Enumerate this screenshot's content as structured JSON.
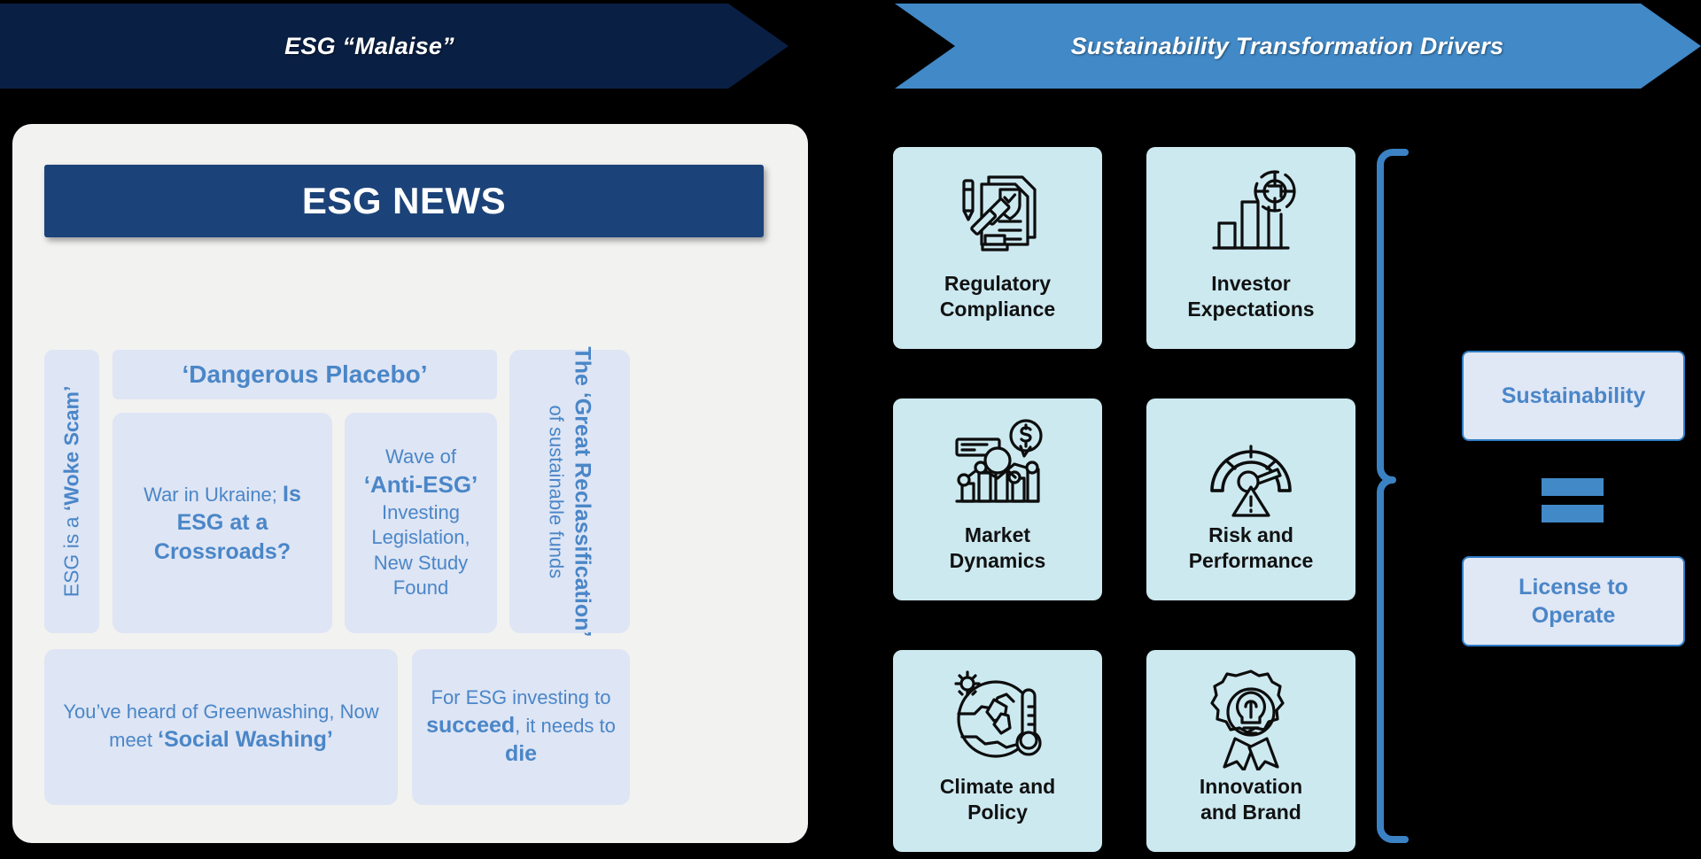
{
  "header": {
    "left_arrow_label": "ESG “Malaise”",
    "right_arrow_label": "Sustainability Transformation Drivers",
    "left_arrow_color": "#0A1F44",
    "right_arrow_color": "#4189C7"
  },
  "news_panel": {
    "title": "ESG NEWS",
    "title_bar_color": "#1C4379",
    "panel_bg": "#F2F2F0",
    "tile_bg": "#DEE5F4",
    "text_color": "#4A86C8",
    "tiles": {
      "woke_scam": {
        "plain": "ESG is a ",
        "bold": "‘Woke Scam’"
      },
      "dangerous_placebo": "‘Dangerous Placebo’",
      "ukraine": {
        "plain_1": "War in Ukraine; ",
        "bold_1": "Is ESG at a Crossroads?"
      },
      "anti_esg": {
        "plain_1": "Wave of ",
        "bold_1": "‘Anti-ESG’",
        "plain_2": " Investing Legislation, New Study Found"
      },
      "reclassification": {
        "line_1": "The ‘Great Reclassification’",
        "line_2": "of sustainable funds"
      },
      "greenwashing": {
        "plain_1": "You’ve heard of Greenwashing, Now meet ",
        "bold_1": "‘Social Washing’"
      },
      "succeed_die": {
        "plain_1": "For ESG investing to ",
        "bold_1": "succeed",
        "plain_2": ", it needs to ",
        "bold_2": "die"
      }
    }
  },
  "drivers": {
    "card_bg": "#CCE9F0",
    "items": [
      {
        "icon": "document-shield-gavel-icon",
        "label_line_1": "Regulatory",
        "label_line_2": "Compliance"
      },
      {
        "icon": "bar-chart-target-icon",
        "label_line_1": "Investor",
        "label_line_2": "Expectations"
      },
      {
        "icon": "market-chart-dollar-icon",
        "label_line_1": "Market",
        "label_line_2": "Dynamics"
      },
      {
        "icon": "gauge-warning-icon",
        "label_line_1": "Risk and",
        "label_line_2": "Performance"
      },
      {
        "icon": "globe-sun-thermometer-icon",
        "label_line_1": "Climate and",
        "label_line_2": "Policy"
      },
      {
        "icon": "award-lightbulb-icon",
        "label_line_1": "Innovation",
        "label_line_2": "and Brand"
      }
    ]
  },
  "outcomes": {
    "brace_color": "#3B82C4",
    "equals_color": "#4189C7",
    "box_border": "#2E7CC4",
    "box_bg": "#E0E7F5",
    "sustainability": "Sustainability",
    "license_line_1": "License to",
    "license_line_2": "Operate"
  }
}
